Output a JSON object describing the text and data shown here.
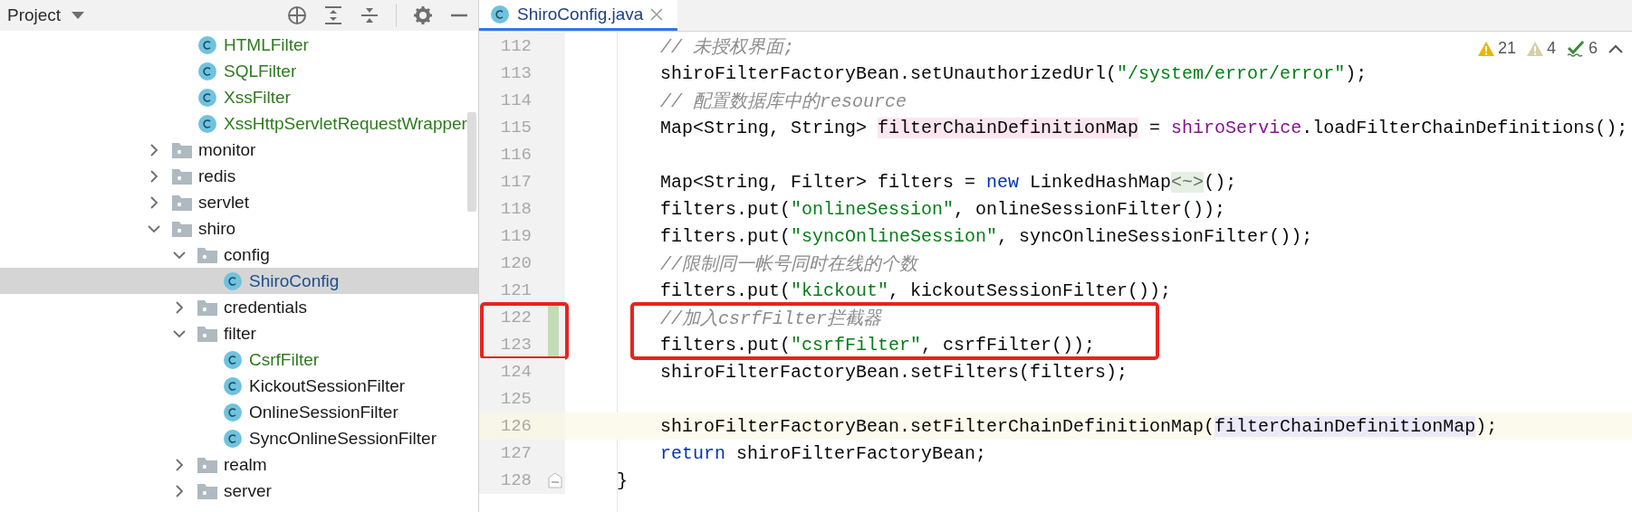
{
  "project_panel": {
    "title": "Project",
    "tree_continued": [
      {
        "kind": "class",
        "label": "HTMLFilter",
        "color": "#2f7a1f",
        "selected": false
      },
      {
        "kind": "class",
        "label": "SQLFilter",
        "color": "#2f7a1f",
        "selected": false
      },
      {
        "kind": "class",
        "label": "XssFilter",
        "color": "#2f7a1f",
        "selected": false
      },
      {
        "kind": "class",
        "label": "XssHttpServletRequestWrapper",
        "color": "#2f7a1f",
        "selected": false
      }
    ],
    "tree": [
      {
        "kind": "folder",
        "label": "monitor",
        "expanded": false,
        "selected": false
      },
      {
        "kind": "folder",
        "label": "redis",
        "expanded": false,
        "selected": false
      },
      {
        "kind": "folder",
        "label": "servlet",
        "expanded": false,
        "selected": false
      },
      {
        "kind": "folder",
        "label": "shiro",
        "expanded": true,
        "selected": false,
        "children": [
          {
            "kind": "folder",
            "label": "config",
            "expanded": true,
            "selected": false,
            "children": [
              {
                "kind": "class",
                "label": "ShiroConfig",
                "color": "#1d4f8c",
                "selected": true
              }
            ]
          },
          {
            "kind": "folder",
            "label": "credentials",
            "expanded": false,
            "selected": false
          },
          {
            "kind": "folder",
            "label": "filter",
            "expanded": true,
            "selected": false,
            "children": [
              {
                "kind": "class",
                "label": "CsrfFilter",
                "color": "#2f7a1f",
                "selected": false
              },
              {
                "kind": "class",
                "label": "KickoutSessionFilter",
                "selected": false
              },
              {
                "kind": "class",
                "label": "OnlineSessionFilter",
                "selected": false
              },
              {
                "kind": "class",
                "label": "SyncOnlineSessionFilter",
                "selected": false
              }
            ]
          },
          {
            "kind": "folder",
            "label": "realm",
            "expanded": false,
            "selected": false
          },
          {
            "kind": "folder",
            "label": "server",
            "expanded": false,
            "selected": false
          }
        ]
      }
    ]
  },
  "editor": {
    "tabs": [
      {
        "label": "ShiroConfig.java",
        "selected": true
      }
    ],
    "inspections": [
      {
        "kind": "warning",
        "count": "21"
      },
      {
        "kind": "weak_warning",
        "count": "4"
      },
      {
        "kind": "typo",
        "count": "6"
      }
    ],
    "lines": [
      {
        "number": "112",
        "kind": "body",
        "tokens": [
          {
            "kind": "comment",
            "text": "// 未授权界面;"
          }
        ]
      },
      {
        "number": "113",
        "kind": "body",
        "tokens": [
          {
            "kind": "plain",
            "text": "shiroFilterFactoryBean.setUnauthorizedUrl("
          },
          {
            "kind": "string",
            "text": "\"/system/error/error\""
          },
          {
            "kind": "plain",
            "text": ");"
          }
        ]
      },
      {
        "number": "114",
        "kind": "body",
        "tokens": [
          {
            "kind": "comment",
            "text": "// 配置数据库中的resource"
          }
        ]
      },
      {
        "number": "115",
        "kind": "body",
        "tokens": [
          {
            "kind": "plain",
            "text": "Map<String, String> "
          },
          {
            "kind": "write_usage",
            "text": "filterChainDefinitionMap"
          },
          {
            "kind": "plain",
            "text": " = "
          },
          {
            "kind": "field",
            "text": "shiroService"
          },
          {
            "kind": "plain",
            "text": ".loadFilterChainDefinitions();"
          }
        ]
      },
      {
        "number": "116",
        "kind": "body"
      },
      {
        "number": "117",
        "kind": "body",
        "tokens": [
          {
            "kind": "plain",
            "text": "Map<String, Filter> filters = "
          },
          {
            "kind": "keyword",
            "text": "new"
          },
          {
            "kind": "plain",
            "text": " LinkedHashMap"
          },
          {
            "kind": "diamond",
            "text": "<~>"
          },
          {
            "kind": "plain",
            "text": "();"
          }
        ]
      },
      {
        "number": "118",
        "kind": "body",
        "tokens": [
          {
            "kind": "plain",
            "text": "filters.put("
          },
          {
            "kind": "string",
            "text": "\"onlineSession\""
          },
          {
            "kind": "plain",
            "text": ", onlineSessionFilter());"
          }
        ]
      },
      {
        "number": "119",
        "kind": "body",
        "tokens": [
          {
            "kind": "plain",
            "text": "filters.put("
          },
          {
            "kind": "string",
            "text": "\"syncOnlineSession\""
          },
          {
            "kind": "plain",
            "text": ", syncOnlineSessionFilter());"
          }
        ]
      },
      {
        "number": "120",
        "kind": "body",
        "tokens": [
          {
            "kind": "comment",
            "text": "//限制同一帐号同时在线的个数"
          }
        ]
      },
      {
        "number": "121",
        "kind": "body",
        "tokens": [
          {
            "kind": "plain",
            "text": "filters.put("
          },
          {
            "kind": "string",
            "text": "\"kickout\""
          },
          {
            "kind": "plain",
            "text": ", kickoutSessionFilter());"
          }
        ]
      },
      {
        "number": "122",
        "kind": "body",
        "changed": true,
        "boxed": true,
        "tokens": [
          {
            "kind": "comment",
            "text": "//加入csrfFilter拦截器"
          }
        ]
      },
      {
        "number": "123",
        "kind": "body",
        "changed": true,
        "boxed": true,
        "tokens": [
          {
            "kind": "plain",
            "text": "filters.put("
          },
          {
            "kind": "string",
            "text": "\"csrfFilter\""
          },
          {
            "kind": "plain",
            "text": ", csrfFilter());"
          }
        ]
      },
      {
        "number": "124",
        "kind": "body",
        "tokens": [
          {
            "kind": "plain",
            "text": "shiroFilterFactoryBean.setFilters(filters);"
          }
        ]
      },
      {
        "number": "125",
        "kind": "body"
      },
      {
        "number": "126",
        "kind": "body",
        "current": true,
        "tokens": [
          {
            "kind": "plain",
            "text": "shiroFilterFactoryBean.setFilterChainDefinitionMap("
          },
          {
            "kind": "read_usage",
            "text": "filterChainDefinitionMap"
          },
          {
            "kind": "plain",
            "text": ");"
          }
        ]
      },
      {
        "number": "127",
        "kind": "body",
        "tokens": [
          {
            "kind": "keyword",
            "text": "return"
          },
          {
            "kind": "plain",
            "text": " shiroFilterFactoryBean;"
          }
        ]
      },
      {
        "number": "128",
        "kind": "method_end",
        "fold": true,
        "tokens": [
          {
            "kind": "plain",
            "text": "}"
          }
        ]
      }
    ]
  }
}
